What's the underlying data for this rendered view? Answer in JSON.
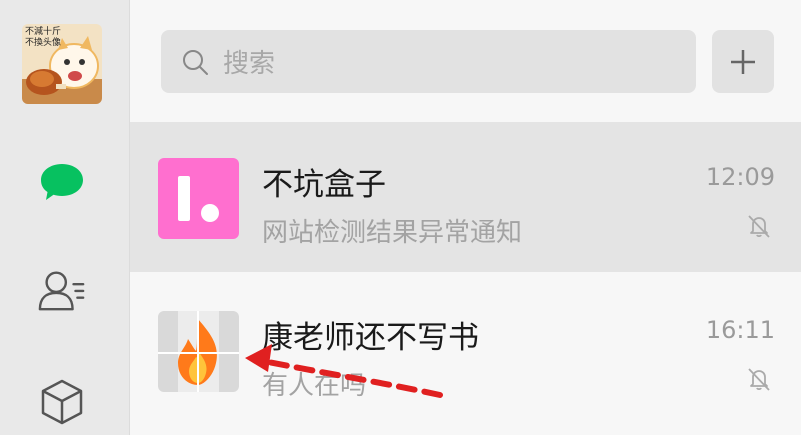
{
  "app": {
    "profile_avatar_text": "不減十斤\n不換头像",
    "profile_avatar_line1": "不減十斤",
    "profile_avatar_line2": "不換头像"
  },
  "sidebar": {
    "items": [
      {
        "name": "chats",
        "icon": "chat-bubble-icon",
        "active": true,
        "color": "#07c160"
      },
      {
        "name": "contacts",
        "icon": "contacts-icon",
        "active": false
      },
      {
        "name": "mini-programs",
        "icon": "cube-icon",
        "active": false
      }
    ]
  },
  "search": {
    "placeholder": "搜索",
    "icon": "search-icon"
  },
  "add_button": {
    "icon": "plus-icon"
  },
  "conversations": [
    {
      "name": "不坑盒子",
      "last_message": "网站检测结果异常通知",
      "time": "12:09",
      "muted": true,
      "active": true,
      "avatar_color": "#ff6fcf"
    },
    {
      "name": "康老师还不写书",
      "last_message": "有人在吗",
      "time": "16:11",
      "muted": true,
      "active": false,
      "avatar_icon": "flame-icon"
    }
  ],
  "annotation": {
    "color": "#e02020",
    "style": "dashed-arrow"
  }
}
